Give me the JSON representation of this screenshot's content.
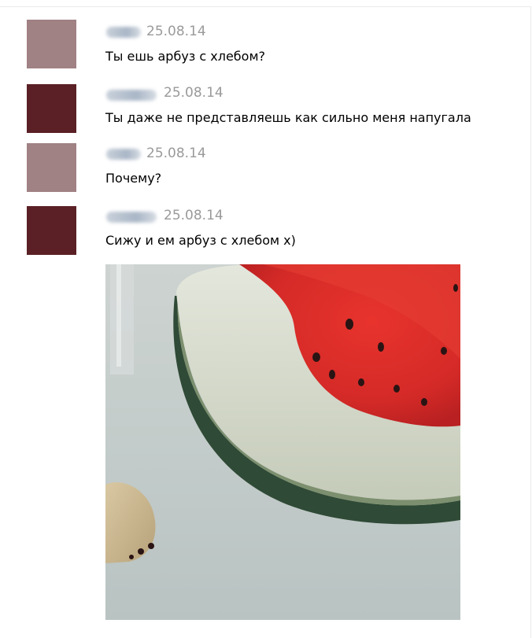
{
  "messages": [
    {
      "date": "25.08.14",
      "text": "Ты ешь арбуз с хлебом?",
      "avatar_color": "#a08184"
    },
    {
      "date": "25.08.14",
      "text": "Ты даже не представляешь как сильно меня напугала",
      "avatar_color": "#5a2025"
    },
    {
      "date": "25.08.14",
      "text": "Почему?",
      "avatar_color": "#a08184"
    },
    {
      "date": "25.08.14",
      "text": "Сижу и ем арбуз с хлебом х)",
      "avatar_color": "#5a2025"
    }
  ],
  "attachment": {
    "type": "photo",
    "subject": "watermelon-and-bread"
  },
  "colors": {
    "date": "#9a9a9a",
    "text": "#000000",
    "background": "#ffffff"
  }
}
